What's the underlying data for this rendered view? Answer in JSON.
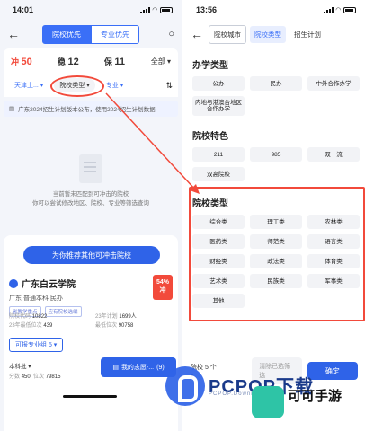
{
  "left": {
    "status_time": "14:01",
    "nav": {
      "tab_active": "院校优先",
      "tab_inactive": "专业优先"
    },
    "tabs": [
      {
        "prefix": "冲",
        "count": "50"
      },
      {
        "prefix": "稳",
        "count": "12"
      },
      {
        "prefix": "保",
        "count": "11"
      }
    ],
    "all_label": "全部",
    "filters": {
      "region": "天津上...",
      "school_type": "院校类型",
      "major": "专业"
    },
    "notice": "广东2024招生计划版本公布，使用2024招生计划数据",
    "empty": {
      "line1": "当前暂未匹配到可冲击的院校",
      "line2": "你可以尝试修改地区、院校、专业等筛选查询"
    },
    "recommend_button": "为你推荐其他可冲击院校",
    "school": {
      "name": "广东白云学院",
      "sub": "广东  普通本科  民办",
      "tags": [
        "省教学重点",
        "应有院校选编"
      ],
      "percent": "54%",
      "percent_label": "冲",
      "stats": {
        "code_label": "院校代码",
        "code": "10822",
        "plan_label": "23年计划",
        "plan": "1699人",
        "minrank_label": "23年最低位次",
        "minrank": "439",
        "minscore_label": "最低位次",
        "minscore": "90758"
      },
      "majors_button": "可报专业组 5",
      "batch": "本科批",
      "score_label": "分数",
      "score": "450",
      "rank_label": "位次",
      "rank": "79815"
    },
    "my_volunteer_button": "我的志愿-...",
    "my_volunteer_count": "(9)"
  },
  "right": {
    "status_time": "13:56",
    "tabs": [
      "院校城市",
      "院校类型",
      "招生计划"
    ],
    "sections": [
      {
        "title": "办学类型",
        "options": [
          "公办",
          "民办",
          "中外合作办学",
          "内地与港澳台地区合作办学"
        ]
      },
      {
        "title": "院校特色",
        "options": [
          "211",
          "985",
          "双一流",
          "双高院校"
        ]
      },
      {
        "title": "院校类型",
        "options": [
          "综合类",
          "理工类",
          "农林类",
          "医药类",
          "师范类",
          "语言类",
          "财经类",
          "政法类",
          "体育类",
          "艺术类",
          "民族类",
          "军事类",
          "其他"
        ]
      }
    ],
    "bottom": {
      "selected": "院校 5 个",
      "clear": "清除已选筛选",
      "confirm": "确定"
    }
  },
  "watermark": {
    "brand": "PCPOP",
    "brand_cn": "下载",
    "sub": "PCPOP.Download",
    "app_cn": "可可手游"
  },
  "colors": {
    "accent": "#2f63e8",
    "highlight": "#f24a3b"
  }
}
